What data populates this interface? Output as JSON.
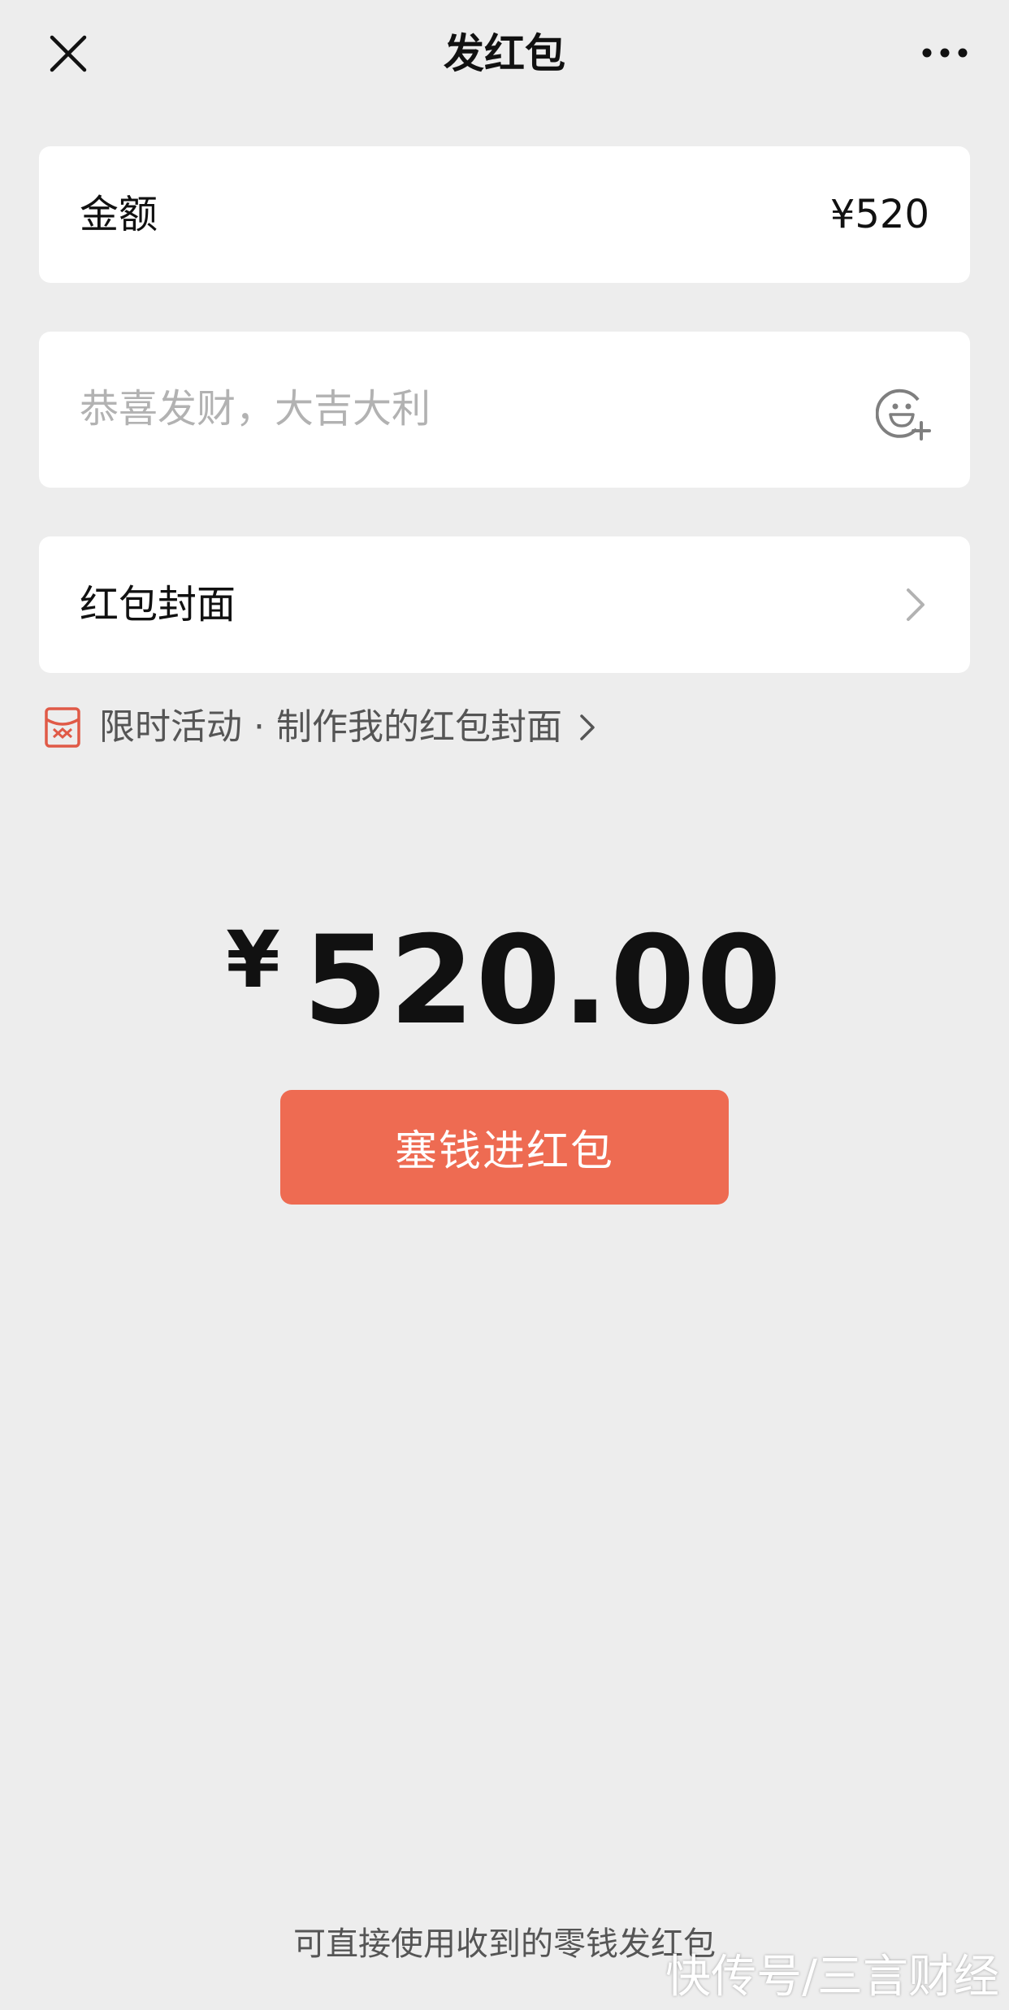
{
  "header": {
    "title": "发红包",
    "close_icon": "close-icon",
    "more_icon": "more-dots-icon"
  },
  "amount_row": {
    "label": "金额",
    "value": "¥520"
  },
  "greeting_row": {
    "placeholder": "恭喜发财，大吉大利",
    "value": "",
    "emoji_icon": "emoji-add-icon"
  },
  "cover_row": {
    "label": "红包封面",
    "chevron_icon": "chevron-right-icon"
  },
  "promo": {
    "text": "限时活动 · 制作我的红包封面",
    "icon": "red-packet-icon",
    "accent_color": "#e05a47"
  },
  "total": {
    "currency": "¥",
    "amount": "520.00"
  },
  "submit": {
    "label": "塞钱进红包",
    "color": "#ee6b52"
  },
  "footer_note": "可直接使用收到的零钱发红包",
  "watermark": "快传号/三言财经"
}
